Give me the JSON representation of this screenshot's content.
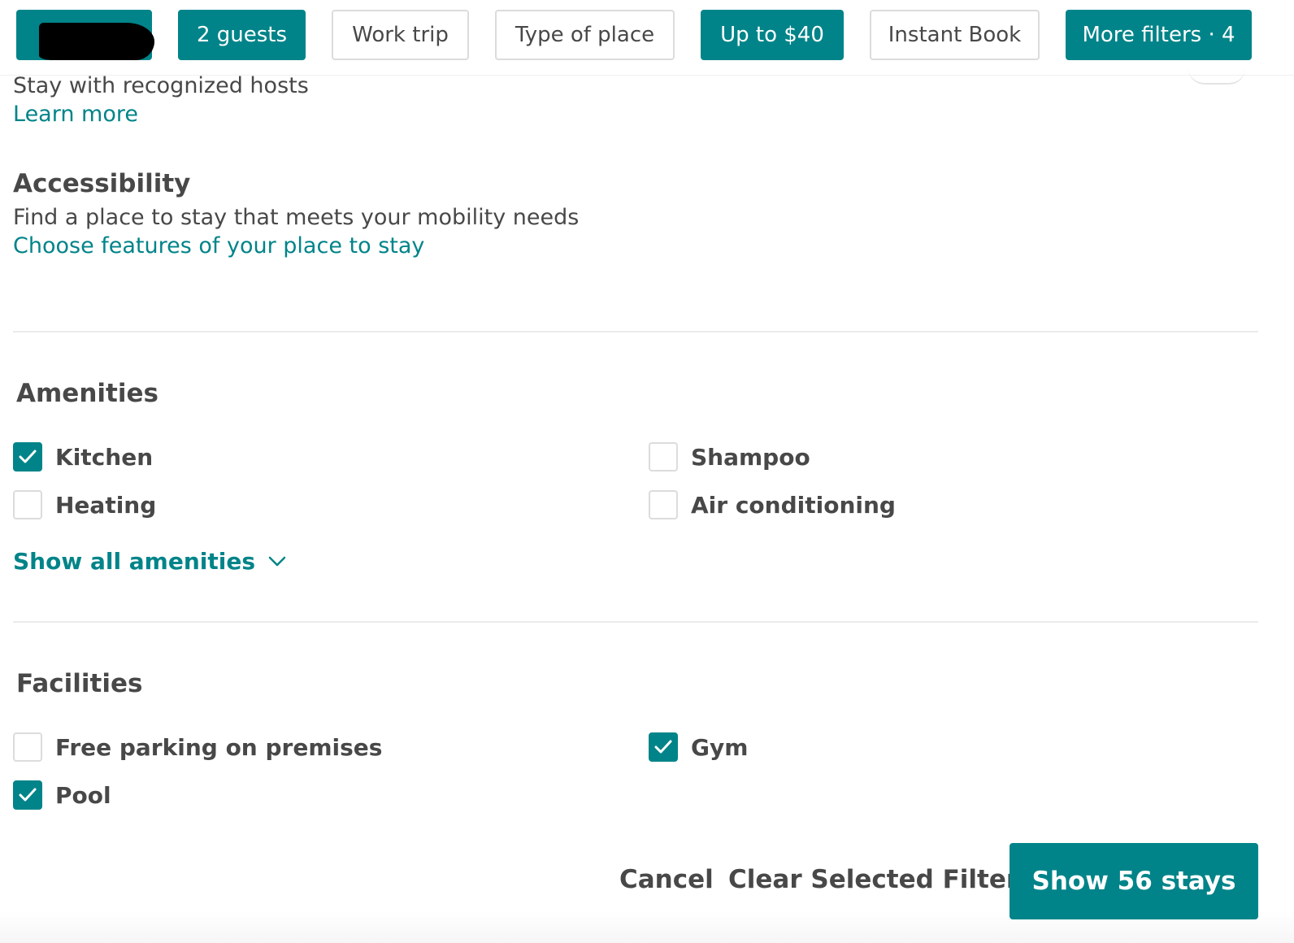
{
  "top_filters": {
    "guests": "2 guests",
    "work_trip": "Work trip",
    "type_of_place": "Type of place",
    "price": "Up to $40",
    "instant_book": "Instant Book",
    "more_filters": "More filters · 4"
  },
  "recognized_hosts": {
    "subtitle": "Stay with recognized hosts",
    "link": "Learn more"
  },
  "accessibility": {
    "title": "Accessibility",
    "subtitle": "Find a place to stay that meets your mobility needs",
    "link": "Choose features of your place to stay"
  },
  "amenities": {
    "title": "Amenities",
    "items": [
      {
        "label": "Kitchen",
        "checked": true
      },
      {
        "label": "Shampoo",
        "checked": false
      },
      {
        "label": "Heating",
        "checked": false
      },
      {
        "label": "Air conditioning",
        "checked": false
      }
    ],
    "show_all": "Show all amenities"
  },
  "facilities": {
    "title": "Facilities",
    "items": [
      {
        "label": "Free parking on premises",
        "checked": false
      },
      {
        "label": "Gym",
        "checked": true
      },
      {
        "label": "Pool",
        "checked": true
      }
    ]
  },
  "footer": {
    "cancel": "Cancel",
    "clear": "Clear Selected Filters",
    "show": "Show 56 stays"
  },
  "colors": {
    "accent": "#008489",
    "text": "#484848",
    "border": "#dcdcdc"
  }
}
